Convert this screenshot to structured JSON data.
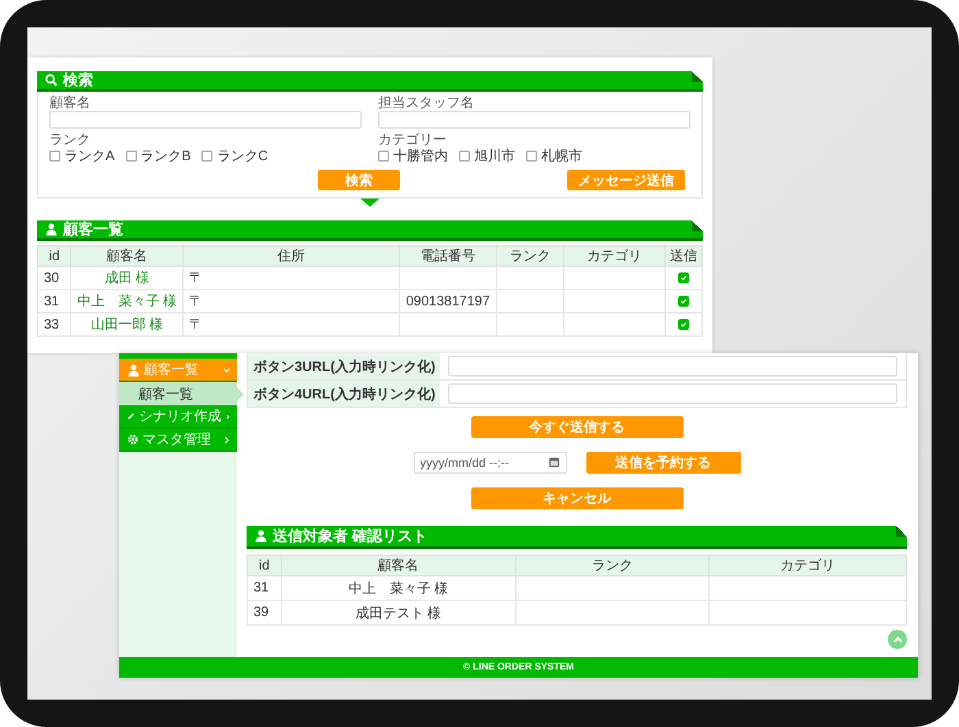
{
  "back_screen": {
    "search_panel": {
      "title": "検索",
      "fields": [
        {
          "label": "顧客名"
        },
        {
          "label": "担当スタッフ名"
        }
      ],
      "filters": [
        {
          "label": "ランク",
          "options": [
            {
              "label": "ランクA",
              "checked": false
            },
            {
              "label": "ランクB",
              "checked": false
            },
            {
              "label": "ランクC",
              "checked": false
            }
          ]
        },
        {
          "label": "カテゴリー",
          "options": [
            {
              "label": "十勝管内",
              "checked": false
            },
            {
              "label": "旭川市",
              "checked": false
            },
            {
              "label": "札幌市",
              "checked": false
            }
          ]
        }
      ],
      "buttons": [
        "検索",
        "メッセージ送信"
      ]
    },
    "customer_list": {
      "title": "顧客一覧",
      "columns": [
        "id",
        "顧客名",
        "住所",
        "電話番号",
        "ランク",
        "カテゴリ",
        "送信"
      ],
      "rows": [
        {
          "id": "30",
          "name": "成田 様",
          "address": "〒",
          "send": true
        },
        {
          "id": "31",
          "name": "中上　菜々子 様",
          "address": "〒",
          "phone": "09013817197",
          "send": true
        },
        {
          "id": "33",
          "name": "山田一郎 様",
          "address": "〒",
          "send": true
        }
      ]
    }
  },
  "front_screen": {
    "sidebar": {
      "items": [
        {
          "label": "顧客一覧",
          "selected": true,
          "expanded": true,
          "children": [
            {
              "label": "顧客一覧",
              "selected": true
            }
          ]
        },
        {
          "label": "シナリオ作成",
          "selected": false,
          "expanded": false
        },
        {
          "label": "マスタ管理",
          "selected": false,
          "expanded": false
        }
      ]
    },
    "form_rows": [
      {
        "label": "ボタン3URL(入力時リンク化)"
      },
      {
        "label": "ボタン4URL(入力時リンク化)"
      }
    ],
    "send_now_button": "今すぐ送信する",
    "schedule": {
      "placeholder": "yyyy/mm/dd --:--",
      "button": "送信を予約する"
    },
    "cancel_button": "キャンセル",
    "recipients": {
      "title": "送信対象者 確認リスト",
      "columns": [
        "id",
        "顧客名",
        "ランク",
        "カテゴリ"
      ],
      "rows": [
        {
          "id": "31",
          "name": "中上　菜々子 様"
        },
        {
          "id": "39",
          "name": "成田テスト 様"
        }
      ]
    },
    "footer": "© LINE ORDER SYSTEM"
  }
}
